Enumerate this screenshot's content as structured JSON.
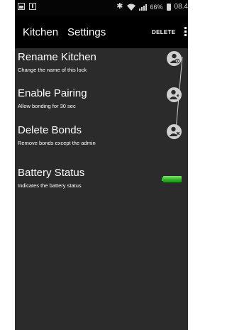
{
  "status_bar": {
    "battery_percent": "66%",
    "time": "08.4"
  },
  "action_bar": {
    "title": "Kitchen",
    "tab": "Settings",
    "delete_label": "DELETE"
  },
  "settings": {
    "rename": {
      "title": "Rename Kitchen",
      "subtitle": "Change the name of this lock",
      "icon": "user-eye-icon"
    },
    "pairing": {
      "title": "Enable Pairing",
      "subtitle": "Allow bonding for 30 sec",
      "icon": "user-add-icon"
    },
    "delete_bonds": {
      "title": "Delete Bonds",
      "subtitle": "Remove bonds except the admin",
      "icon": "user-remove-icon"
    },
    "battery": {
      "title": "Battery Status",
      "subtitle": "Indicates the battery status",
      "icon": "battery-full-icon",
      "level": 1.0
    }
  },
  "colors": {
    "background": "#2b2b2b",
    "action_bar": "#000000",
    "status_bar": "#050505",
    "battery_green": "#34b32a",
    "icon_gray": "#d0d0d0"
  }
}
